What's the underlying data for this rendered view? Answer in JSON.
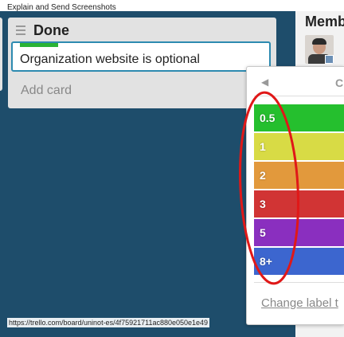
{
  "caption": "Explain and Send Screenshots",
  "list": {
    "title": "Done",
    "card": {
      "text": "Organization website is optional",
      "label_color": "#2ab335"
    },
    "add_card": "Add card"
  },
  "sidebar": {
    "members_title": "Memb"
  },
  "popover": {
    "back": "◀",
    "title": "C",
    "labels": [
      {
        "text": "0.5",
        "color": "#25bf2e"
      },
      {
        "text": "1",
        "color": "#d8db45"
      },
      {
        "text": "2",
        "color": "#e2993c"
      },
      {
        "text": "3",
        "color": "#d13434"
      },
      {
        "text": "5",
        "color": "#8a2fbf"
      },
      {
        "text": "8+",
        "color": "#3c66cf"
      }
    ],
    "change_link": "Change label t"
  },
  "status_url": "https://trello.com/board/uninot-es/4f75921711ac880e050e1e49",
  "colors": {
    "board_bg": "#1e4d6b",
    "annotation": "#e01818"
  }
}
